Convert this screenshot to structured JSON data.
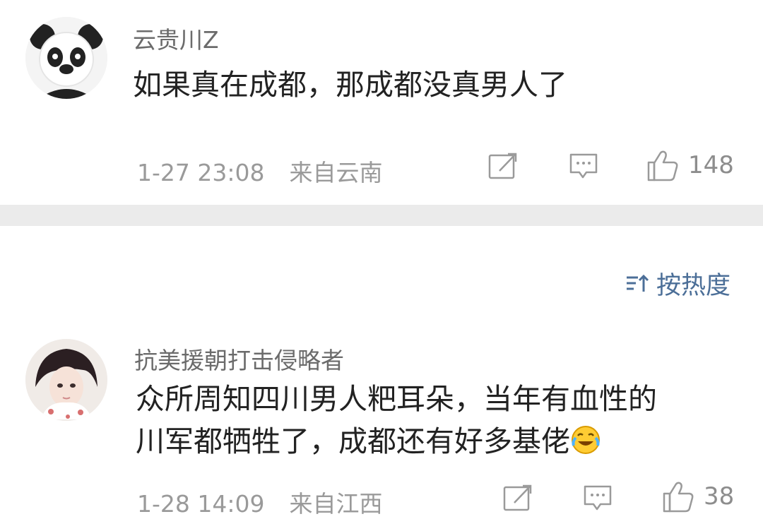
{
  "sort": {
    "label": "按热度",
    "icon": "sort-icon",
    "color": "#4c6f98"
  },
  "comments": [
    {
      "username": "云贵川Z",
      "text_lines": [
        "如果真在成都，那成都没真男人了"
      ],
      "timestamp": "1-27 23:08",
      "location": "来自云南",
      "like_count": "148",
      "avatar": "panda-avatar"
    },
    {
      "username": "抗美援朝打击侵略者",
      "text_lines": [
        "众所周知四川男人粑耳朵，当年有血性的",
        "川军都牺牲了，成都还有好多基佬"
      ],
      "emoji": "laughing-crying-emoji",
      "timestamp": "1-28 14:09",
      "location": "来自江西",
      "like_count": "38",
      "avatar": "girl-avatar"
    }
  ]
}
